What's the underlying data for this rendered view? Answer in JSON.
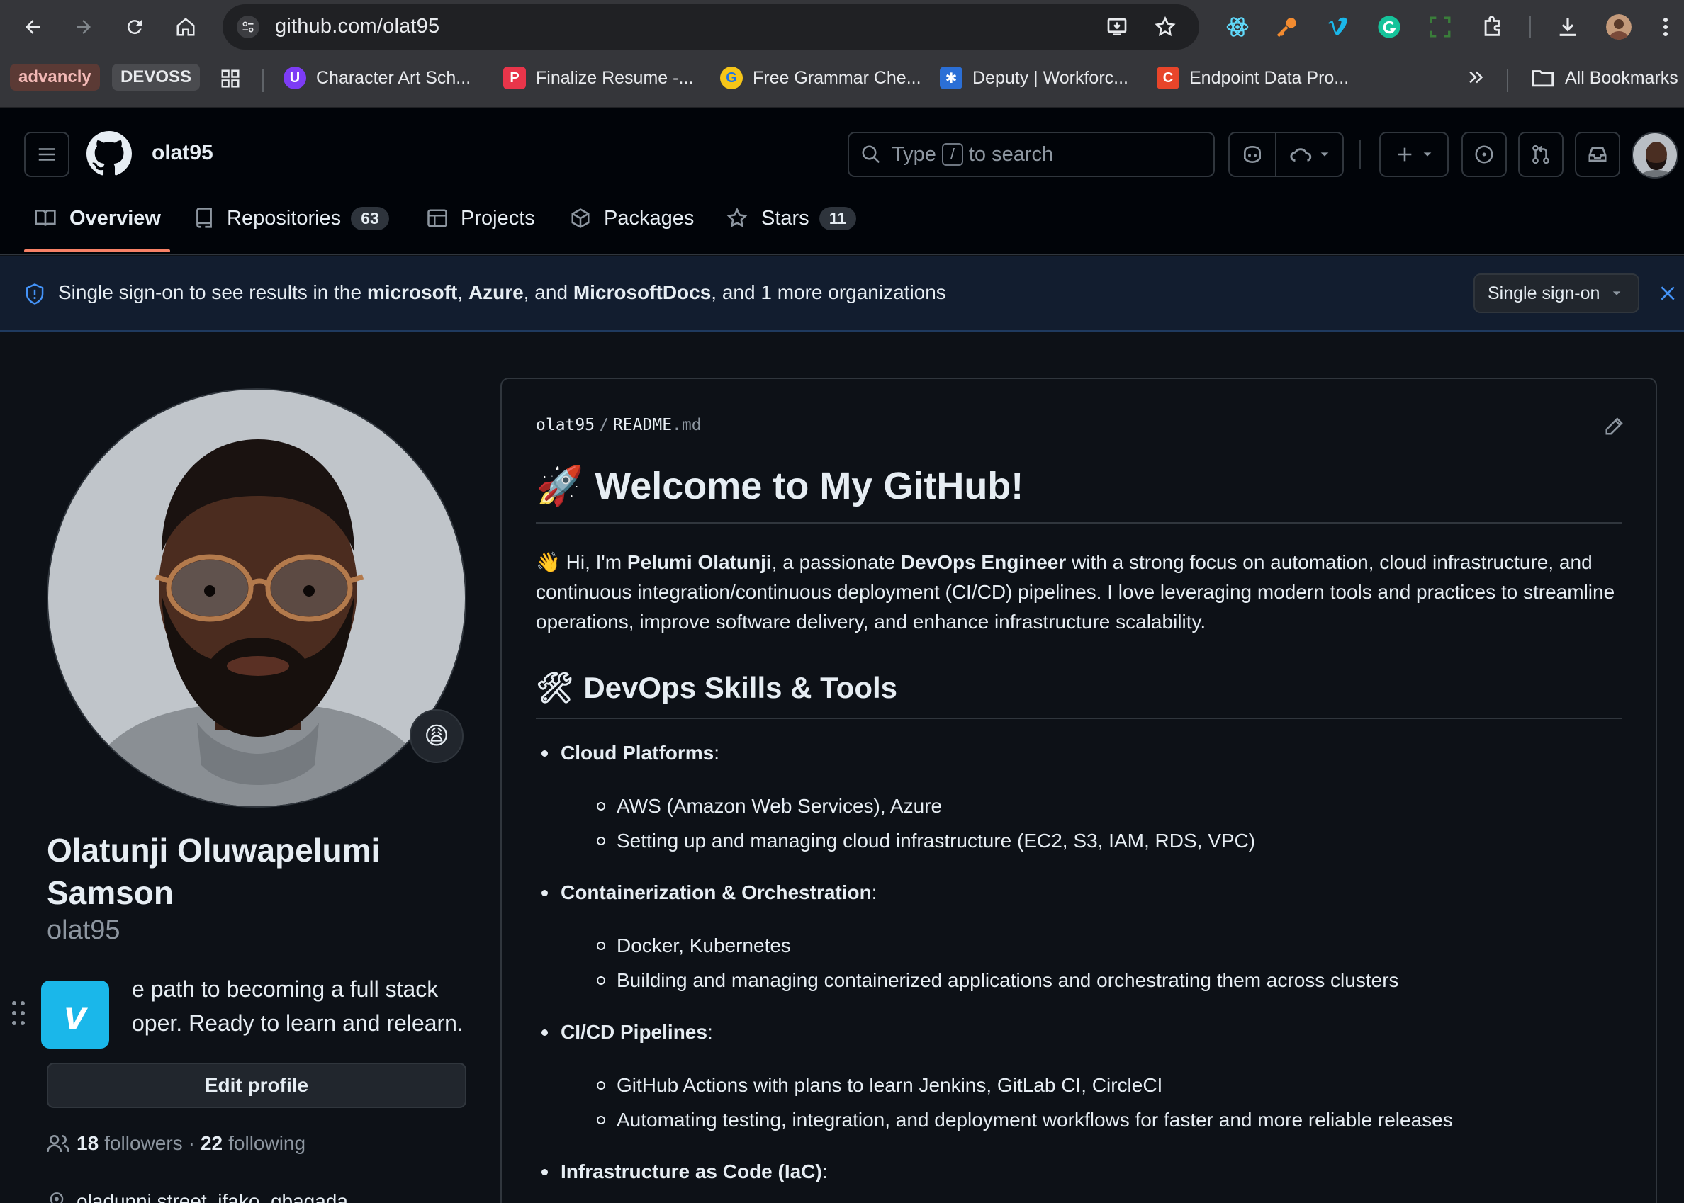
{
  "browser": {
    "url": "github.com/olat95",
    "bookmarks_pills": [
      "advancly",
      "DEVOSS"
    ],
    "bookmarks": [
      {
        "label": "Character Art Sch...",
        "icon": "unacademy-icon"
      },
      {
        "label": "Finalize Resume -...",
        "icon": "resume-icon"
      },
      {
        "label": "Free Grammar Che...",
        "icon": "grammar-icon"
      },
      {
        "label": "Deputy | Workforc...",
        "icon": "deputy-icon"
      },
      {
        "label": "Endpoint Data Pro...",
        "icon": "endpoint-icon"
      }
    ],
    "all_bookmarks": "All Bookmarks"
  },
  "github": {
    "username": "olat95",
    "search_prefix": "Type",
    "search_key": "/",
    "search_suffix": "to search",
    "tabs": [
      {
        "label": "Overview",
        "icon": "book-icon"
      },
      {
        "label": "Repositories",
        "icon": "repo-icon",
        "count": "63"
      },
      {
        "label": "Projects",
        "icon": "table-icon"
      },
      {
        "label": "Packages",
        "icon": "package-icon"
      },
      {
        "label": "Stars",
        "icon": "star-icon",
        "count": "11"
      }
    ]
  },
  "sso_banner": {
    "text_start": "Single sign-on to see results in the ",
    "org1": "microsoft",
    "sep1": ", ",
    "org2": "Azure",
    "sep2": ", and ",
    "org3": "MicrosoftDocs",
    "text_end": ", and 1 more organizations",
    "button": "Single sign-on"
  },
  "profile": {
    "full_name": "Olatunji Oluwapelumi Samson",
    "login": "olat95",
    "status_emoji": "😩",
    "bio_line1": "e path to becoming a full stack",
    "bio_line2": "oper. Ready to learn and relearn.",
    "edit_button": "Edit profile",
    "followers_count": "18",
    "followers_label": "followers",
    "following_count": "22",
    "following_label": "following",
    "location": "oladunni street, ifako, gbagada"
  },
  "readme": {
    "path_user": "olat95",
    "path_sep": "/",
    "path_file": "README",
    "path_ext": ".md",
    "h1_emoji": "🚀",
    "h1": "Welcome to My GitHub!",
    "intro_emoji": "👋",
    "intro_1": " Hi, I'm ",
    "intro_name": "Pelumi Olatunji",
    "intro_2": ", a passionate ",
    "intro_role": "DevOps Engineer",
    "intro_3": " with a strong focus on automation, cloud infrastructure, and continuous integration/continuous deployment (CI/CD) pipelines. I love leveraging modern tools and practices to streamline operations, improve software delivery, and enhance infrastructure scalability.",
    "h2_emoji": "🛠",
    "h2": "DevOps Skills & Tools",
    "skills": [
      {
        "title": "Cloud Platforms",
        "items": [
          "AWS (Amazon Web Services), Azure",
          "Setting up and managing cloud infrastructure (EC2, S3, IAM, RDS, VPC)"
        ]
      },
      {
        "title": "Containerization & Orchestration",
        "items": [
          "Docker, Kubernetes",
          "Building and managing containerized applications and orchestrating them across clusters"
        ]
      },
      {
        "title": "CI/CD Pipelines",
        "items": [
          "GitHub Actions with plans to learn Jenkins, GitLab CI, CircleCI",
          "Automating testing, integration, and deployment workflows for faster and more reliable releases"
        ]
      },
      {
        "title": "Infrastructure as Code (IaC)",
        "items": []
      }
    ]
  },
  "colors": {
    "accent_underline": "#f78166",
    "vimeo": "#1ab7ea",
    "banner_bg": "#121d2f"
  }
}
